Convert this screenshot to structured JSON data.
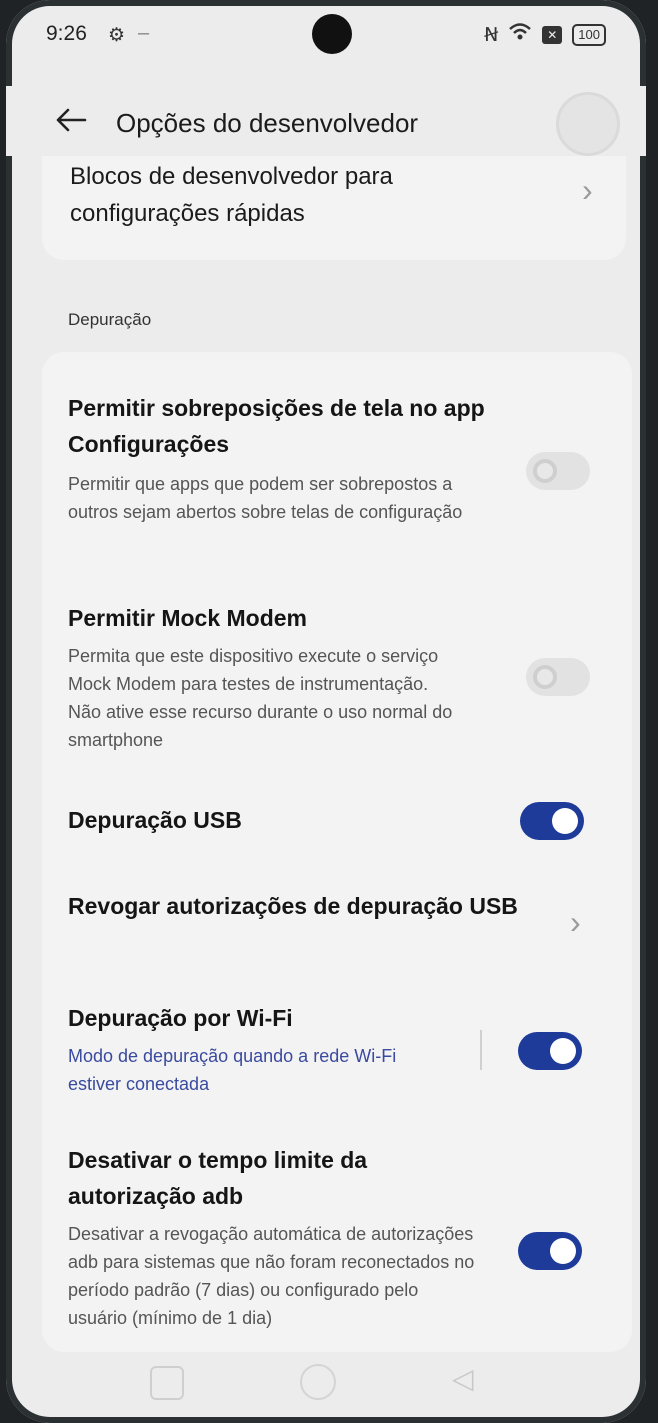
{
  "status_bar": {
    "time": "9:26",
    "battery": "100"
  },
  "header": {
    "title": "Opções do desenvolvedor"
  },
  "quick_settings_card": {
    "label": "Blocos de desenvolvedor para configurações rápidas"
  },
  "section": {
    "label": "Depuração"
  },
  "items": [
    {
      "title": "Permitir sobreposições de tela no app Configurações",
      "description": "Permitir que apps que podem ser sobrepostos a outros sejam abertos sobre telas de configuração",
      "toggle": "off"
    },
    {
      "title": "Permitir Mock Modem",
      "description": "Permita que este dispositivo execute o serviço Mock Modem para testes de instrumentação. Não ative esse recurso durante o uso normal do smartphone",
      "toggle": "off"
    },
    {
      "title": "Depuração USB",
      "toggle": "on"
    },
    {
      "title": "Revogar autorizações de depuração USB"
    },
    {
      "title": "Depuração por Wi-Fi",
      "description": "Modo de depuração quando a rede Wi-Fi estiver conectada",
      "toggle": "on"
    },
    {
      "title": "Desativar o tempo limite da autorização adb",
      "description": "Desativar a revogação automática de autorizações adb para sistemas que não foram reconectados no período padrão (7 dias) ou configurado pelo usuário (mínimo de 1 dia)",
      "toggle": "on"
    }
  ],
  "icons": {
    "back": "arrow-left-icon",
    "chevron": "chevron-right-icon"
  },
  "colors": {
    "toggle_on": "#1f3b9a",
    "background": "#ececec",
    "card": "#f3f3f3"
  }
}
